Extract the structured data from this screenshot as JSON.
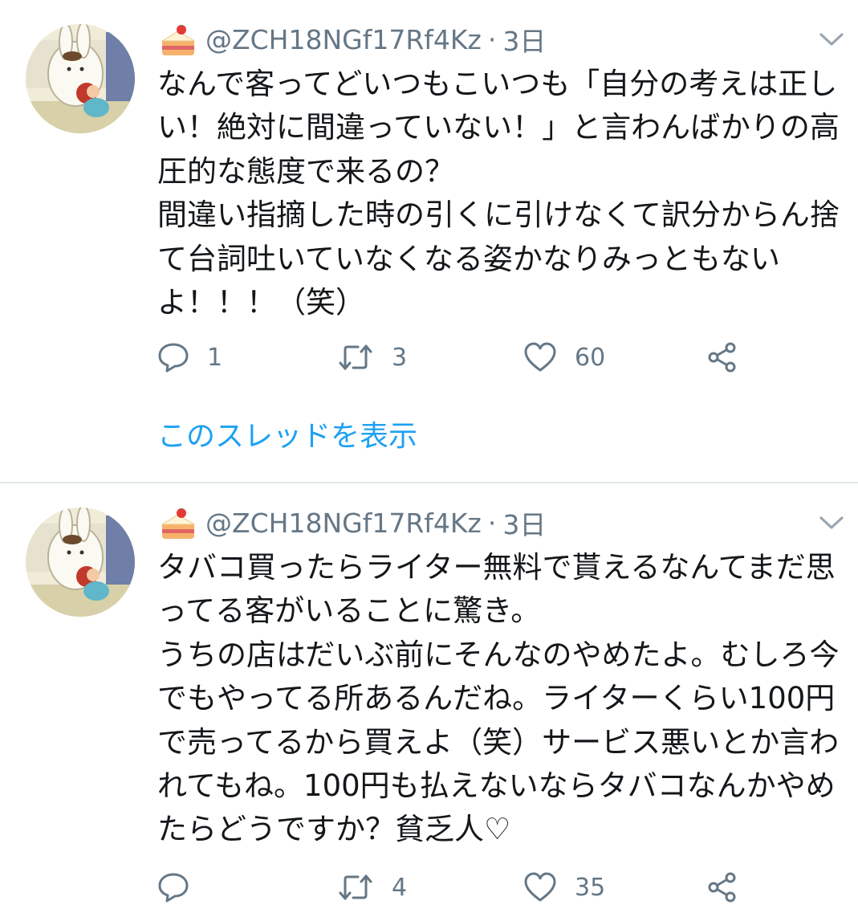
{
  "tweets": [
    {
      "handle": "@ZCH18NGf17Rf4Kz",
      "separator": "·",
      "time": "3日",
      "text": "なんで客ってどいつもこいつも「自分の考えは正しい！絶対に間違っていない！」と言わんばかりの高圧的な態度で来るの？\n間違い指摘した時の引くに引けなくて訳分からん捨て台詞吐いていなくなる姿かなりみっともないよ！！！（笑）",
      "replies": "1",
      "retweets": "3",
      "likes": "60",
      "show_thread": "このスレッドを表示"
    },
    {
      "handle": "@ZCH18NGf17Rf4Kz",
      "separator": "·",
      "time": "3日",
      "text": "タバコ買ったらライター無料で貰えるなんてまだ思ってる客がいることに驚き。\nうちの店はだいぶ前にそんなのやめたよ。むしろ今でもやってる所あるんだね。ライターくらい100円で売ってるから買えよ（笑）サービス悪いとか言われてもね。100円も払えないならタバコなんかやめたらどうですか？貧乏人♡",
      "replies": "",
      "retweets": "4",
      "likes": "35"
    }
  ],
  "icons": {
    "header": "birthday-cake-icon",
    "menu": "chevron-down-icon",
    "reply": "reply-icon",
    "retweet": "retweet-icon",
    "like": "heart-icon",
    "share": "share-icon"
  },
  "colors": {
    "text": "#14171a",
    "muted": "#657786",
    "link": "#1da1f2",
    "divider": "#e1e8ed"
  }
}
